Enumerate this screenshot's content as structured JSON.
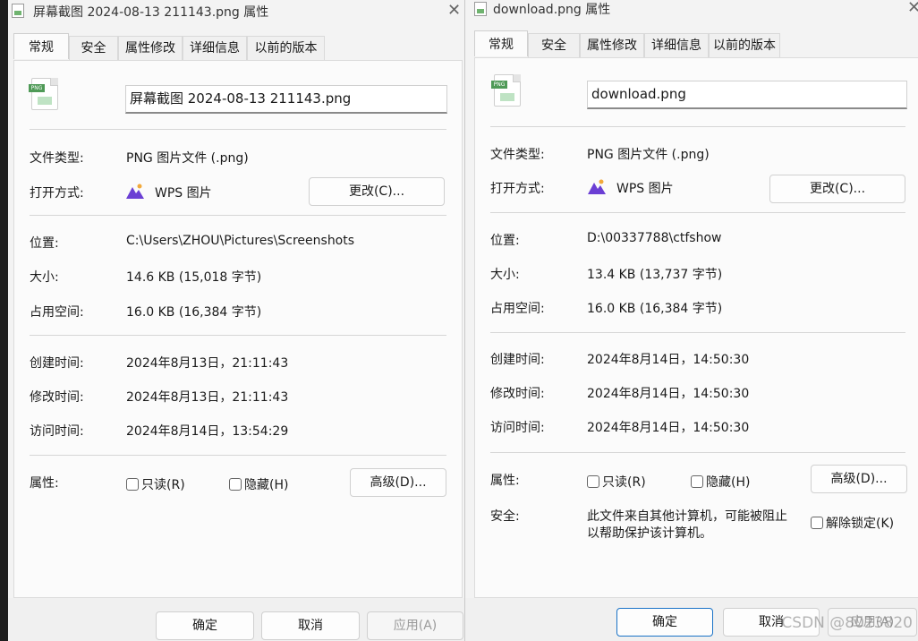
{
  "dialogs": [
    {
      "window_title": "屏幕截图 2024-08-13 211143.png 属性",
      "tabs": [
        "常规",
        "安全",
        "属性修改",
        "详细信息",
        "以前的版本"
      ],
      "active_tab": "常规",
      "file_name": "屏幕截图 2024-08-13 211143.png",
      "file_icon_tag": "PNG",
      "type_label": "文件类型:",
      "type_value": "PNG 图片文件 (.png)",
      "open_with_label": "打开方式:",
      "open_with_value": "WPS 图片",
      "change_button": "更改(C)...",
      "location_label": "位置:",
      "location_value": "C:\\Users\\ZHOU\\Pictures\\Screenshots",
      "size_label": "大小:",
      "size_value": "14.6 KB (15,018 字节)",
      "disk_label": "占用空间:",
      "disk_value": "16.0 KB (16,384 字节)",
      "created_label": "创建时间:",
      "created_value": "2024年8月13日，21:11:43",
      "modified_label": "修改时间:",
      "modified_value": "2024年8月13日，21:11:43",
      "accessed_label": "访问时间:",
      "accessed_value": "2024年8月14日，13:54:29",
      "attributes_label": "属性:",
      "readonly_label": "只读(R)",
      "hidden_label": "隐藏(H)",
      "advanced_button": "高级(D)...",
      "ok_button": "确定",
      "cancel_button": "取消",
      "apply_button": "应用(A)"
    },
    {
      "window_title": "download.png 属性",
      "tabs": [
        "常规",
        "安全",
        "属性修改",
        "详细信息",
        "以前的版本"
      ],
      "active_tab": "常规",
      "file_name": "download.png",
      "file_icon_tag": "PNG",
      "type_label": "文件类型:",
      "type_value": "PNG 图片文件 (.png)",
      "open_with_label": "打开方式:",
      "open_with_value": "WPS 图片",
      "change_button": "更改(C)...",
      "location_label": "位置:",
      "location_value": "D:\\00337788\\ctfshow",
      "size_label": "大小:",
      "size_value": "13.4 KB (13,737 字节)",
      "disk_label": "占用空间:",
      "disk_value": "16.0 KB (16,384 字节)",
      "created_label": "创建时间:",
      "created_value": "2024年8月14日，14:50:30",
      "modified_label": "修改时间:",
      "modified_value": "2024年8月14日，14:50:30",
      "accessed_label": "访问时间:",
      "accessed_value": "2024年8月14日，14:50:30",
      "attributes_label": "属性:",
      "readonly_label": "只读(R)",
      "hidden_label": "隐藏(H)",
      "advanced_button": "高级(D)...",
      "security_label": "安全:",
      "security_text_line1": "此文件来自其他计算机，可能被阻止",
      "security_text_line2": "以帮助保护该计算机。",
      "unblock_label": "解除锁定(K)",
      "ok_button": "确定",
      "cancel_button": "取消",
      "apply_button": "应用(A)"
    }
  ],
  "watermark": "CSDN @8023820",
  "colors": {
    "window_bg": "#f3f3f3",
    "panel_bg": "#fbfbfb",
    "primary_border": "#1a73c7",
    "wps_icon": "#6b3fd4"
  }
}
